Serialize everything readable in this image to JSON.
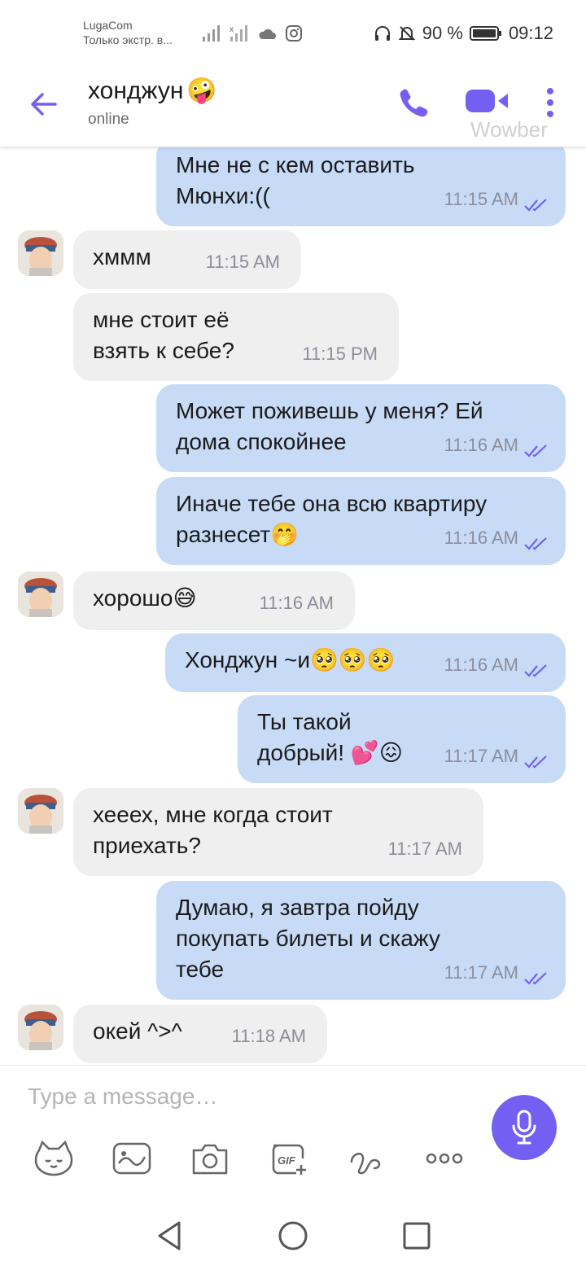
{
  "status_bar": {
    "carrier_name": "LugaCom",
    "carrier_status": "Только экстр. в...",
    "battery": "90 %",
    "time": "09:12"
  },
  "header": {
    "contact_name": "хонджун",
    "contact_emoji": "🤪",
    "status": "online",
    "watermark": "Wowber",
    "accent_color": "#7360f2"
  },
  "messages": [
    {
      "dir": "out",
      "text": "Мне не с кем оставить Мюнхи:((",
      "time": "11:15 AM"
    },
    {
      "dir": "in",
      "text": "хммм",
      "time": "11:15 AM"
    },
    {
      "dir": "in",
      "text": "мне стоит её взять к себе?",
      "time": "11:15 PM"
    },
    {
      "dir": "out",
      "text": "Может поживешь у меня? Ей дома спокойнее",
      "time": "11:16 AM"
    },
    {
      "dir": "out",
      "text": "Иначе тебе она всю квартиру разнесет🤭",
      "time": "11:16 AM"
    },
    {
      "dir": "in",
      "text": "хорошо😅",
      "time": "11:16 AM"
    },
    {
      "dir": "out",
      "text": "Хонджун ~и🥺🥺🥺",
      "time": "11:16 AM"
    },
    {
      "dir": "out",
      "text": "Ты такой добрый! 💕😖",
      "time": "11:17 AM"
    },
    {
      "dir": "in",
      "text": "хееех, мне когда стоит приехать?",
      "time": "11:17 AM"
    },
    {
      "dir": "out",
      "text": "Думаю, я завтра пойду покупать билеты и скажу тебе",
      "time": "11:17 AM"
    },
    {
      "dir": "in",
      "text": "окей ^>^",
      "time": "11:18 AM"
    }
  ],
  "composer": {
    "placeholder": "Type a message…"
  },
  "icons": {
    "back": "arrow-left-icon",
    "call": "phone-icon",
    "video": "video-camera-icon",
    "more": "more-vertical-icon",
    "mic": "microphone-icon",
    "sticker": "sticker-face-icon",
    "doodle": "doodle-icon",
    "camera": "camera-icon",
    "gif": "gif-icon",
    "scribble": "scribble-icon",
    "dots": "more-horizontal-icon"
  }
}
